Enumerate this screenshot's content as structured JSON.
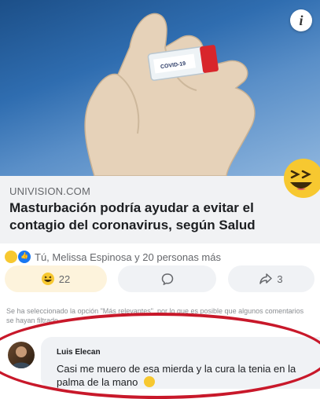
{
  "post": {
    "image_caption": "COVID-19",
    "link": {
      "source": "UNIVISION.COM",
      "headline": "Masturbación podría ayudar a evitar el contagio del coronavirus, según Salud"
    },
    "reactions_summary": "Tú, Melissa Espinosa y 20 personas más",
    "actions": {
      "reaction_count": "22",
      "share_count": "3"
    }
  },
  "comments": {
    "notice": "Se ha seleccionado la opción \"Más relevantes\", por lo que es posible que algunos comentarios se hayan filtrado.",
    "items": [
      {
        "author": "Luis Elecan",
        "text": "Casi me muero de esa mierda y la cura la tenia en la palma de la mano"
      }
    ]
  },
  "colors": {
    "highlight_oval": "#c8182a",
    "haha_yellow": "#f7c830",
    "like_blue": "#1877f2"
  },
  "icons": [
    "info-icon",
    "haha-emoji-icon",
    "like-icon",
    "comment-icon",
    "share-icon",
    "smile-emoji-icon"
  ]
}
